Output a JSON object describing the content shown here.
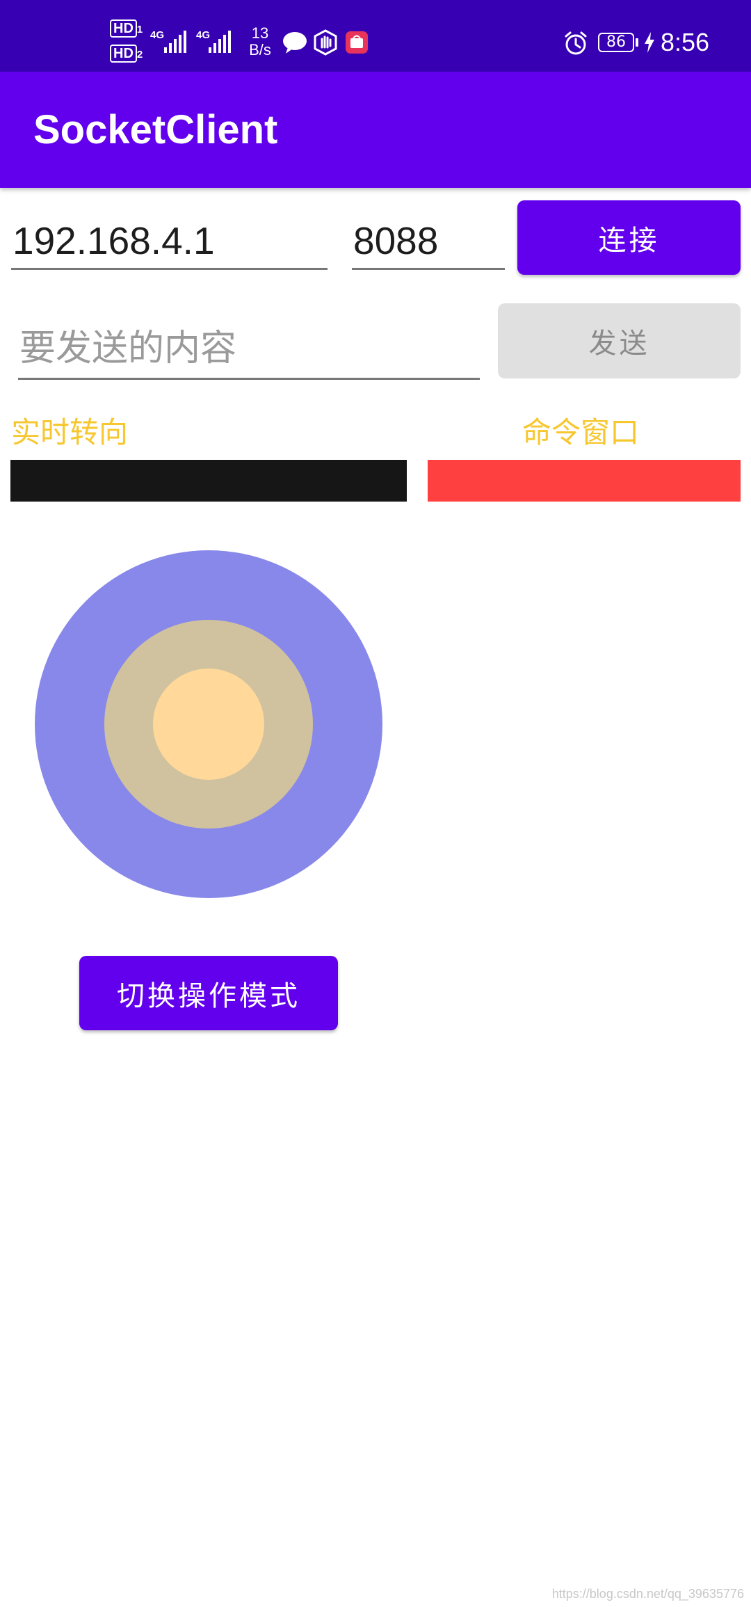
{
  "status_bar": {
    "hd1": "HD",
    "hd1_sub": "1",
    "hd2": "HD",
    "hd2_sub": "2",
    "net1": "4G",
    "net2": "4G",
    "speed_value": "13",
    "speed_unit": "B/s",
    "battery": "86",
    "time": "8:56",
    "icons": [
      "message-icon",
      "hand-shield-icon",
      "app-notification-icon",
      "alarm-icon",
      "charging-icon"
    ]
  },
  "app_bar": {
    "title": "SocketClient"
  },
  "connection": {
    "ip_value": "192.168.4.1",
    "port_value": "8088",
    "connect_label": "连接"
  },
  "message": {
    "placeholder": "要发送的内容",
    "send_label": "发送"
  },
  "labels": {
    "realtime_direction": "实时转向",
    "command_window": "命令窗口"
  },
  "switch_mode_label": "切换操作模式",
  "watermark": "https://blog.csdn.net/qq_39635776",
  "colors": {
    "status_bar": "#3700B3",
    "app_bar": "#6200EE",
    "accent_yellow": "#F7C72F",
    "direction_bar": "#161616",
    "command_bar": "#FF4040",
    "joystick_outer": "#8888EA",
    "joystick_middle": "#D0C29E",
    "joystick_inner": "#FFD89A"
  }
}
